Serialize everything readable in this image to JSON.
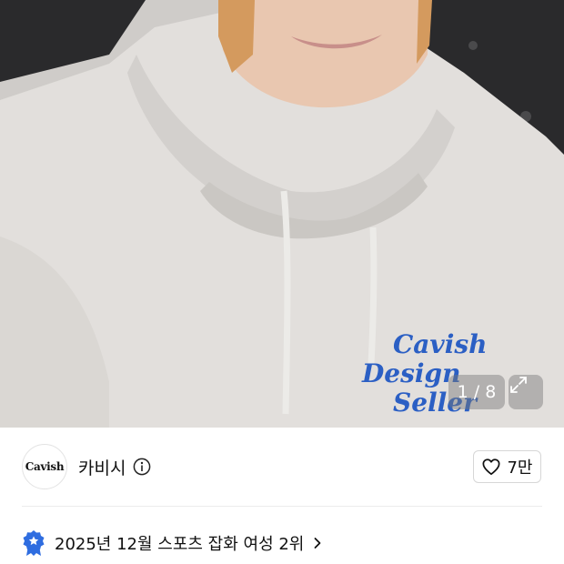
{
  "gallery": {
    "counter": "1 / 8",
    "print_text": [
      "Cavish",
      "Design",
      "Seller"
    ],
    "print_color": "#2b5fc4",
    "expand_icon": "expand-icon"
  },
  "shop": {
    "logo_text": "Cavish",
    "name": "카비시",
    "info_icon": "info-icon"
  },
  "like": {
    "icon": "heart-icon",
    "count": "7만"
  },
  "ranking": {
    "icon": "badge-icon",
    "text": "2025년 12월 스포츠 잡화 여성 2위",
    "badge_color": "#2f6de0"
  }
}
